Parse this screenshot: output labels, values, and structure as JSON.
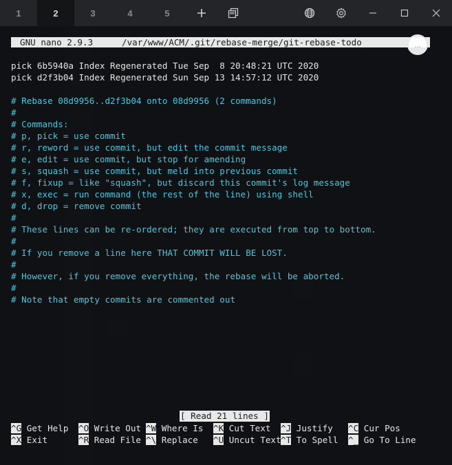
{
  "tabs": [
    {
      "label": "1"
    },
    {
      "label": "2"
    },
    {
      "label": "3"
    },
    {
      "label": "4"
    },
    {
      "label": "5"
    }
  ],
  "header": {
    "version": "GNU nano 2.9.3",
    "path": "/var/www/ACM/.git/rebase-merge/git-rebase-todo"
  },
  "scroll_indicator": "...",
  "file_lines": [
    {
      "text": "pick 6b5940a Index Regenerated Tue Sep  8 20:48:21 UTC 2020",
      "kind": "pick"
    },
    {
      "text": "pick d2f3b04 Index Regenerated Sun Sep 13 14:57:12 UTC 2020",
      "kind": "pick"
    },
    {
      "text": "",
      "kind": "blank"
    },
    {
      "text": "# Rebase 08d9956..d2f3b04 onto 08d9956 (2 commands)",
      "kind": "comment"
    },
    {
      "text": "#",
      "kind": "comment"
    },
    {
      "text": "# Commands:",
      "kind": "comment"
    },
    {
      "text": "# p, pick = use commit",
      "kind": "comment"
    },
    {
      "text": "# r, reword = use commit, but edit the commit message",
      "kind": "comment"
    },
    {
      "text": "# e, edit = use commit, but stop for amending",
      "kind": "comment"
    },
    {
      "text": "# s, squash = use commit, but meld into previous commit",
      "kind": "comment"
    },
    {
      "text": "# f, fixup = like \"squash\", but discard this commit's log message",
      "kind": "comment"
    },
    {
      "text": "# x, exec = run command (the rest of the line) using shell",
      "kind": "comment"
    },
    {
      "text": "# d, drop = remove commit",
      "kind": "comment"
    },
    {
      "text": "#",
      "kind": "comment"
    },
    {
      "text": "# These lines can be re-ordered; they are executed from top to bottom.",
      "kind": "comment"
    },
    {
      "text": "#",
      "kind": "comment"
    },
    {
      "text": "# If you remove a line here THAT COMMIT WILL BE LOST.",
      "kind": "comment"
    },
    {
      "text": "#",
      "kind": "comment"
    },
    {
      "text": "# However, if you remove everything, the rebase will be aborted.",
      "kind": "comment"
    },
    {
      "text": "#",
      "kind": "comment"
    },
    {
      "text": "# Note that empty commits are commented out",
      "kind": "comment"
    }
  ],
  "status_message": "[ Read 21 lines ]",
  "shortcuts_row1": [
    {
      "key": "^G",
      "label": "Get Help"
    },
    {
      "key": "^O",
      "label": "Write Out"
    },
    {
      "key": "^W",
      "label": "Where Is"
    },
    {
      "key": "^K",
      "label": "Cut Text"
    },
    {
      "key": "^J",
      "label": "Justify"
    },
    {
      "key": "^C",
      "label": "Cur Pos"
    }
  ],
  "shortcuts_row2": [
    {
      "key": "^X",
      "label": "Exit"
    },
    {
      "key": "^R",
      "label": "Read File"
    },
    {
      "key": "^\\",
      "label": "Replace"
    },
    {
      "key": "^U",
      "label": "Uncut Text"
    },
    {
      "key": "^T",
      "label": "To Spell"
    },
    {
      "key": "^_",
      "label": "Go To Line"
    }
  ],
  "colors": {
    "comment": "#4fc6dc",
    "text": "#e6e6e6",
    "inverse_bg": "#e8e8e8"
  },
  "icons": [
    "new-tab-icon",
    "tabs-overview-icon",
    "globe-icon",
    "gear-icon",
    "minimize-icon",
    "maximize-icon",
    "close-icon"
  ]
}
